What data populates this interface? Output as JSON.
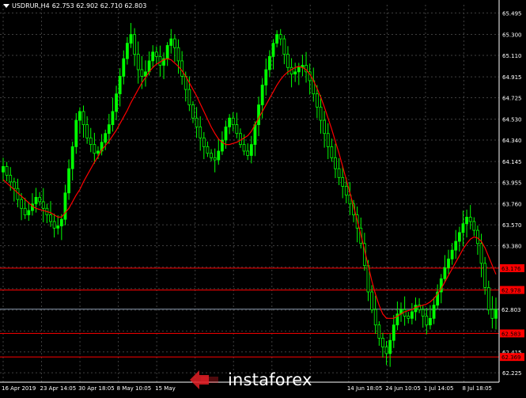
{
  "header": {
    "symbol": "USDRUR,H4",
    "ohlc": "62.753 62.902 62.710 62.803"
  },
  "watermark": {
    "text": "instaforex"
  },
  "colors": {
    "background": "#000000",
    "candle": "#00ff00",
    "moving_average": "#ff0000",
    "level_line": "#ff0000",
    "current_line": "#8c9bb0",
    "grid": "#3f3f3f",
    "text": "#ffffff"
  },
  "chart_data": {
    "type": "candlestick",
    "title": "",
    "xlabel": "",
    "ylabel": "",
    "ylim": [
      62.14,
      65.57
    ],
    "grid": true,
    "y_ticks": [
      "65.495",
      "65.300",
      "65.110",
      "64.915",
      "64.725",
      "64.530",
      "64.340",
      "64.145",
      "63.955",
      "63.760",
      "63.570",
      "63.380",
      "63.185",
      "62.990",
      "62.795",
      "62.605",
      "62.415",
      "62.225"
    ],
    "x_ticks": [
      "16 Apr 2019",
      "23 Apr 14:05",
      "30 Apr 18:05",
      "8 May 10:05",
      "15 May",
      "",
      "",
      "",
      "",
      "14 Jun 18:05",
      "24 Jun 10:05",
      "1 Jul 14:05",
      "8 Jul 18:05"
    ],
    "horizontal_levels": [
      {
        "value": 63.176,
        "label": "63.176"
      },
      {
        "value": 62.978,
        "label": "62.978"
      },
      {
        "value": 62.583,
        "label": "62.583"
      },
      {
        "value": 62.369,
        "label": "62.369"
      }
    ],
    "current_price": {
      "value": 62.803,
      "label": "62.803"
    },
    "closes": [
      64.1,
      64.02,
      63.96,
      63.9,
      63.8,
      63.72,
      63.66,
      63.7,
      63.76,
      63.82,
      63.78,
      63.72,
      63.66,
      63.6,
      63.54,
      63.56,
      63.62,
      63.86,
      64.08,
      64.28,
      64.52,
      64.6,
      64.48,
      64.36,
      64.3,
      64.22,
      64.24,
      64.32,
      64.4,
      64.48,
      64.6,
      64.76,
      64.92,
      65.08,
      65.22,
      65.3,
      65.12,
      64.98,
      64.92,
      64.96,
      65.06,
      65.14,
      65.1,
      65.02,
      65.08,
      65.2,
      65.26,
      65.18,
      65.06,
      64.92,
      64.8,
      64.66,
      64.54,
      64.46,
      64.36,
      64.28,
      64.22,
      64.18,
      64.16,
      64.24,
      64.34,
      64.46,
      64.54,
      64.48,
      64.4,
      64.3,
      64.24,
      64.2,
      64.3,
      64.48,
      64.66,
      64.84,
      64.98,
      65.1,
      65.22,
      65.3,
      65.26,
      65.12,
      65.0,
      64.94,
      64.96,
      65.0,
      65.02,
      64.96,
      64.88,
      64.76,
      64.64,
      64.52,
      64.4,
      64.28,
      64.18,
      64.08,
      64.0,
      63.92,
      63.84,
      63.76,
      63.66,
      63.54,
      63.4,
      63.2,
      62.96,
      62.8,
      62.66,
      62.54,
      62.46,
      62.4,
      62.52,
      62.66,
      62.76,
      62.8,
      62.74,
      62.72,
      62.78,
      62.84,
      62.8,
      62.74,
      62.66,
      62.72,
      62.84,
      62.96,
      63.08,
      63.18,
      63.26,
      63.34,
      63.42,
      63.5,
      63.58,
      63.64,
      63.6,
      63.52,
      63.4,
      63.22,
      63.0,
      62.8,
      62.72,
      62.8
    ],
    "ma_period": 21,
    "ma_values": [
      63.98,
      63.95,
      63.92,
      63.89,
      63.86,
      63.83,
      63.8,
      63.77,
      63.74,
      63.72,
      63.71,
      63.7,
      63.69,
      63.68,
      63.66,
      63.64,
      63.64,
      63.68,
      63.72,
      63.78,
      63.84,
      63.89,
      63.96,
      64.02,
      64.08,
      64.14,
      64.19,
      64.25,
      64.29,
      64.33,
      64.38,
      64.43,
      64.49,
      64.55,
      64.61,
      64.68,
      64.74,
      64.8,
      64.86,
      64.91,
      64.96,
      65.0,
      65.03,
      65.05,
      65.07,
      65.08,
      65.07,
      65.04,
      65.01,
      64.97,
      64.92,
      64.86,
      64.8,
      64.74,
      64.67,
      64.6,
      64.53,
      64.46,
      64.4,
      64.35,
      64.32,
      64.3,
      64.3,
      64.31,
      64.32,
      64.34,
      64.36,
      64.38,
      64.42,
      64.48,
      64.54,
      64.6,
      64.66,
      64.72,
      64.78,
      64.84,
      64.89,
      64.93,
      64.96,
      64.98,
      65.0,
      65.01,
      65.0,
      64.98,
      64.94,
      64.88,
      64.81,
      64.73,
      64.64,
      64.54,
      64.44,
      64.33,
      64.22,
      64.1,
      63.98,
      63.86,
      63.74,
      63.61,
      63.48,
      63.34,
      63.2,
      63.06,
      62.94,
      62.84,
      62.76,
      62.72,
      62.72,
      62.72,
      62.74,
      62.76,
      62.78,
      62.79,
      62.8,
      62.82,
      62.83,
      62.84,
      62.85,
      62.87,
      62.9,
      62.94,
      62.99,
      63.05,
      63.11,
      63.17,
      63.23,
      63.29,
      63.35,
      63.4,
      63.44,
      63.46,
      63.45,
      63.42,
      63.36,
      63.28,
      63.2,
      63.12
    ]
  }
}
